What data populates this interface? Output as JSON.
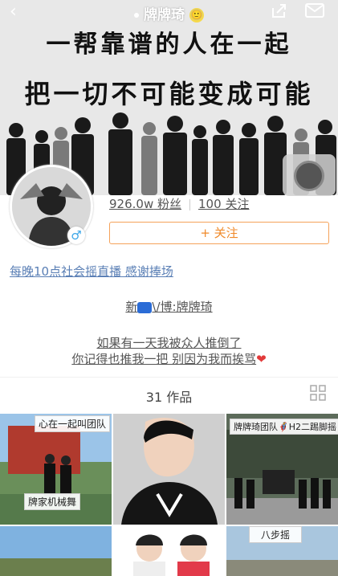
{
  "header": {
    "title": "牌牌琦",
    "emoji": "🙂"
  },
  "banner": {
    "line1": "一帮靠谱的人在一起",
    "line2": "把一切不可能变成可能"
  },
  "profile": {
    "fans_value": "926.0w",
    "fans_label": "粉丝",
    "follows_value": "100",
    "follows_label": "关注",
    "follow_button": "+ 关注",
    "gender_symbol": "♂"
  },
  "bio": {
    "line1": "每晚10点社会摇直播 感谢捧场",
    "weibo_prefix": "新",
    "weibo_suffix": "\\/博:牌牌琦",
    "quote1": "如果有一天我被众人推倒了",
    "quote2": "你记得也推我一把 别因为我而挨骂",
    "heart": "❤"
  },
  "works": {
    "count_label": "31 作品",
    "items": [
      {
        "top_tag": "心在一起叫团队",
        "bottom_tag": "牌家机械舞"
      },
      {
        "top_tag": "",
        "bottom_tag": ""
      },
      {
        "top_tag": "牌牌琦团队🦸H2二踢脚摇",
        "bottom_tag": ""
      },
      {
        "top_tag": "",
        "bottom_tag": ""
      },
      {
        "top_tag": "",
        "bottom_tag": ""
      },
      {
        "top_tag": "八步摇",
        "bottom_tag": ""
      }
    ]
  },
  "colors": {
    "accent": "#f08a2a",
    "link": "#5a7fb5",
    "gender": "#3aa6e8"
  }
}
